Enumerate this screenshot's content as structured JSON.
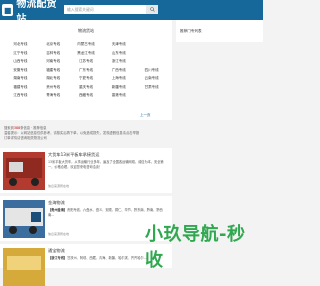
{
  "header": {
    "logo_text": "物流配货站",
    "search_placeholder": "输入搜索关键词"
  },
  "routes": {
    "title": "物流货站",
    "items": [
      "河北专线",
      "北京专线",
      "内蒙古专线",
      "天津专线",
      "",
      "辽宁专线",
      "吉林专线",
      "黑龙江专线",
      "山东专线",
      "",
      "山西专线",
      "河南专线",
      "江苏专线",
      "浙江专线",
      "",
      "安徽专线",
      "福建专线",
      "广东专线",
      "广西专线",
      "四川专线",
      "湖南专线",
      "湖北专线",
      "宁夏专线",
      "上海专线",
      "云南专线",
      "福建专线",
      "贵州专线",
      "重庆专线",
      "新疆专线",
      "甘肃专线",
      "江西专线",
      "青海专线",
      "西藏专线",
      "香港专线",
      ""
    ],
    "pager": "上一页"
  },
  "notice": {
    "line1_prefix": "搜索到",
    "line1_red": "388",
    "line1_suffix": "条信息 · 推荐信息",
    "line2": "温馨提示：以网站信息仅供参考，请核实后再下单，以免造成损失，发现虚假信息请点击举报",
    "line3": "订单详情请咨询相关物流公司"
  },
  "cards": [
    {
      "title": "大货车13米平板车承接货运",
      "body": "13米平板大货车，从事运输行业多年，遍及了全国各运输网络，诚信为本，安全第一，价格合理，欢迎您来电咨询洽谈！",
      "location": "信息来源所在地"
    },
    {
      "title": "金海物流",
      "body_label": "【贵州金海】",
      "body": "贵阳专线、六盘水、遵义、安顺、铜仁、毕节、黔东南、黔南、黔西南...",
      "location": "信息来源所在地"
    },
    {
      "title": "通宝物流",
      "body_label": "【浙江专线】",
      "body": "甘孜州、阿坝、西藏、青海、新疆、哈尔滨、齐齐哈尔..."
    }
  ],
  "side": {
    "title": "推荐门专列表"
  },
  "watermark": "小玖导航-秒收"
}
